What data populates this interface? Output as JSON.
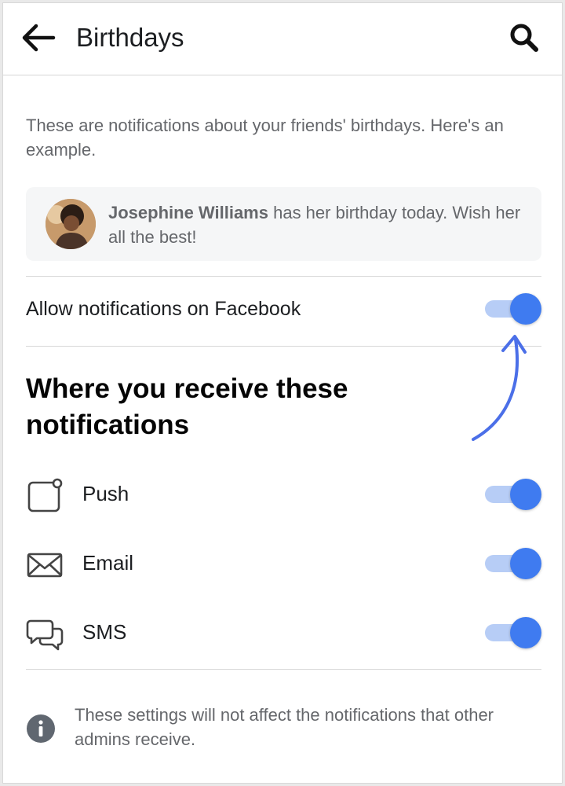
{
  "header": {
    "title": "Birthdays",
    "back_icon": "arrow-left-icon",
    "search_icon": "search-icon"
  },
  "intro": {
    "text": "These are notifications about your friends' birthdays. Here's an example."
  },
  "example": {
    "name": "Josephine Williams",
    "message": " has her birthday today. Wish her all the best!"
  },
  "main_setting": {
    "label": "Allow notifications on Facebook",
    "enabled": true
  },
  "channels_section": {
    "heading": "Where you receive these notifications",
    "items": [
      {
        "label": "Push",
        "icon": "push-device-icon",
        "enabled": true
      },
      {
        "label": "Email",
        "icon": "envelope-icon",
        "enabled": true
      },
      {
        "label": "SMS",
        "icon": "chat-bubbles-icon",
        "enabled": true
      }
    ]
  },
  "footer": {
    "icon": "info-icon",
    "text": "These settings will not affect the notifications that other admins receive."
  },
  "colors": {
    "accent": "#3f7bf0",
    "toggle_track": "#b7cdf6",
    "secondary_text": "#65676b",
    "card_background": "#f5f6f7"
  }
}
